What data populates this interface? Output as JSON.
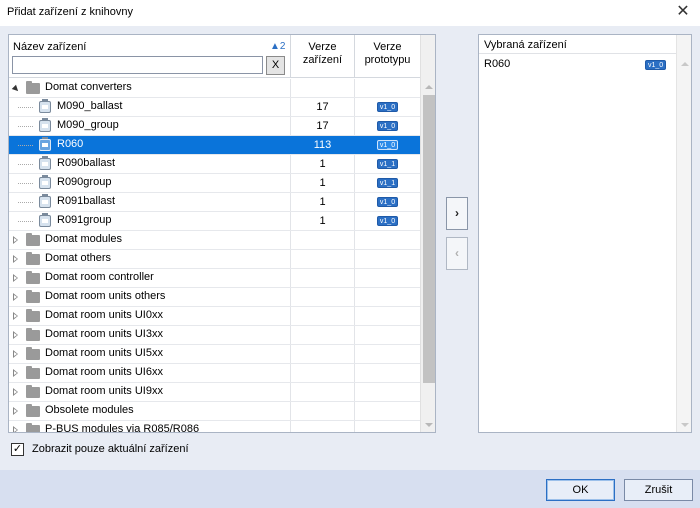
{
  "window": {
    "title": "Přidat zařízení z knihovny",
    "close_glyph": "✕"
  },
  "left": {
    "header": {
      "name_label": "Název zařízení",
      "sort_indicator": "▲2",
      "filter_value": "",
      "clear_label": "X",
      "device_version_label": "Verze zařízení",
      "prototype_version_label": "Verze prototypu"
    },
    "tree": {
      "group": {
        "label": "Domat converters",
        "expanded": true
      },
      "devices": [
        {
          "name": "M090_ballast",
          "device_version": "17",
          "prototype_version": "v1_0",
          "selected": false
        },
        {
          "name": "M090_group",
          "device_version": "17",
          "prototype_version": "v1_0",
          "selected": false
        },
        {
          "name": "R060",
          "device_version": "113",
          "prototype_version": "v1_0",
          "selected": true
        },
        {
          "name": "R090ballast",
          "device_version": "1",
          "prototype_version": "v1_1",
          "selected": false
        },
        {
          "name": "R090group",
          "device_version": "1",
          "prototype_version": "v1_1",
          "selected": false
        },
        {
          "name": "R091ballast",
          "device_version": "1",
          "prototype_version": "v1_0",
          "selected": false
        },
        {
          "name": "R091group",
          "device_version": "1",
          "prototype_version": "v1_0",
          "selected": false
        }
      ],
      "categories": [
        "Domat modules",
        "Domat others",
        "Domat room controller",
        "Domat room units others",
        "Domat room units UI0xx",
        "Domat room units UI3xx",
        "Domat room units UI5xx",
        "Domat room units UI6xx",
        "Domat room units UI9xx",
        "Obsolete modules",
        "P-BUS modules via R085/R086"
      ]
    }
  },
  "move_buttons": {
    "add_label": "›",
    "remove_label": "‹"
  },
  "right": {
    "header": "Vybraná zařízení",
    "items": [
      {
        "name": "R060",
        "prototype_version": "v1_0"
      }
    ]
  },
  "options": {
    "show_current_only_label": "Zobrazit pouze aktuální zařízení",
    "show_current_only_checked": true,
    "check_glyph": "✓"
  },
  "footer": {
    "ok_label": "OK",
    "cancel_label": "Zrušit"
  }
}
